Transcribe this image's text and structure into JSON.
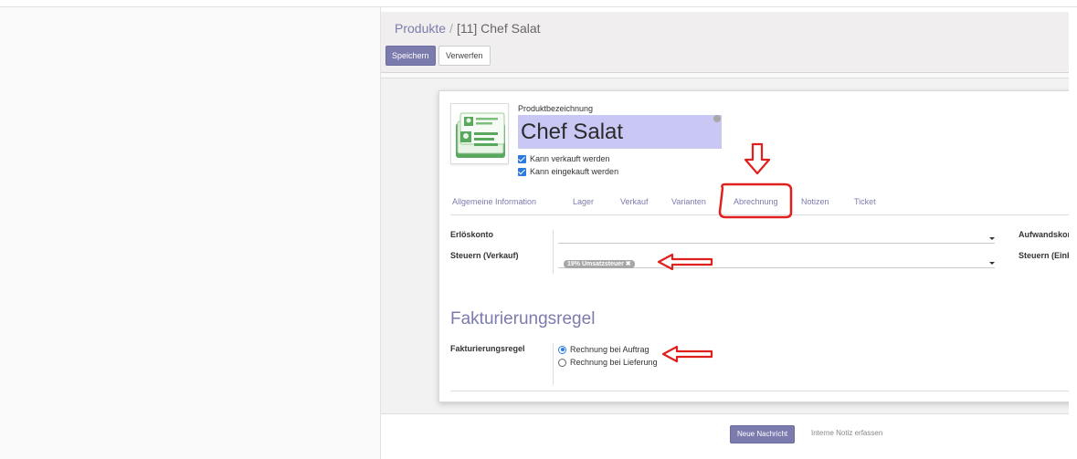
{
  "breadcrumb": {
    "parent": "Produkte",
    "separator": "/",
    "current": "[11] Chef Salat"
  },
  "toolbar": {
    "save_label": "Speichern",
    "discard_label": "Verwerfen"
  },
  "product": {
    "name_label": "Produktbezeichnung",
    "name": "Chef Salat",
    "can_be_sold_label": "Kann verkauft werden",
    "can_be_purchased_label": "Kann eingekauft werden",
    "can_be_sold": true,
    "can_be_purchased": true
  },
  "tabs": [
    {
      "label": "Allgemeine Information"
    },
    {
      "label": "Lager"
    },
    {
      "label": "Verkauf"
    },
    {
      "label": "Varianten"
    },
    {
      "label": "Abrechnung",
      "active": true
    },
    {
      "label": "Notizen"
    },
    {
      "label": "Ticket"
    }
  ],
  "accounting": {
    "income_account_label": "Erlöskonto",
    "income_account_value": "",
    "sales_taxes_label": "Steuern (Verkauf)",
    "sales_tax_tag": "19% Umsatzsteuer ✖",
    "expense_account_label": "Aufwandskor",
    "purchase_taxes_label": "Steuern (Eink"
  },
  "invoicing": {
    "section_title": "Fakturierungsregel",
    "policy_label": "Fakturierungsregel",
    "options": [
      {
        "label": "Rechnung bei Auftrag",
        "selected": true
      },
      {
        "label": "Rechnung bei Lieferung",
        "selected": false
      }
    ]
  },
  "chatter": {
    "new_message_label": "Neue Nachricht",
    "log_note_label": "Interne Notiz erfassen"
  },
  "colors": {
    "accent": "#7c7bad",
    "name_highlight": "#c9c8f5",
    "checkbox": "#2d7be0",
    "annotation": "#e0201e"
  }
}
